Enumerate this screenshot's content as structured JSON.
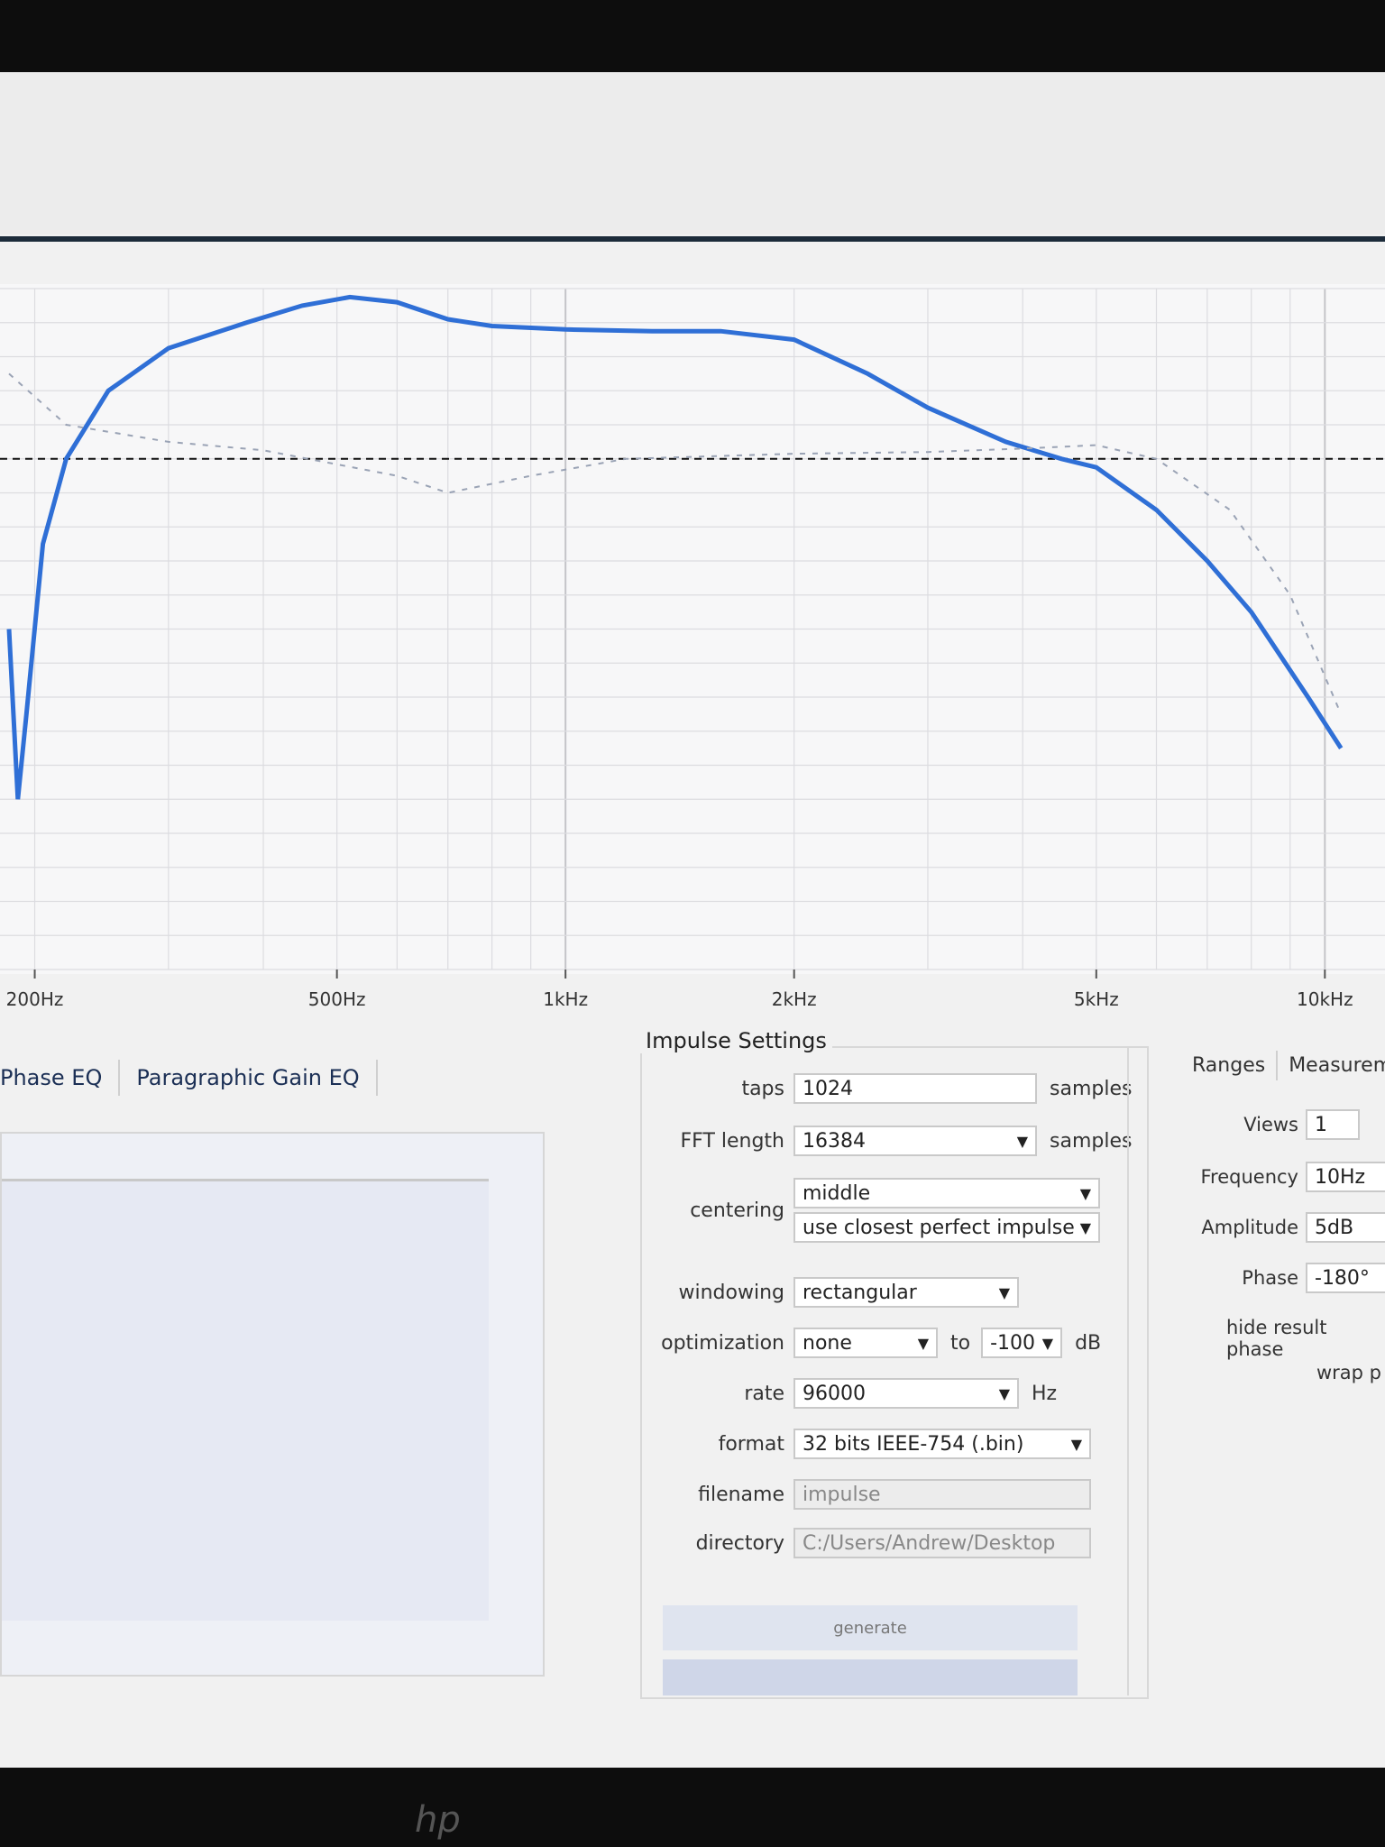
{
  "chart_data": {
    "type": "line",
    "x_scale": "log",
    "x_ticks": [
      "200Hz",
      "500Hz",
      "1kHz",
      "2kHz",
      "5kHz",
      "10kHz"
    ],
    "x_tick_values": [
      200,
      500,
      1000,
      2000,
      5000,
      10000
    ],
    "xlim": [
      180,
      12000
    ],
    "ylim": [
      -30,
      10
    ],
    "grid": true,
    "zero_line": 0,
    "series": [
      {
        "style": "solid",
        "color": "#2f6fd6",
        "points": [
          [
            185,
            -10
          ],
          [
            190,
            -20
          ],
          [
            195,
            -15
          ],
          [
            205,
            -5
          ],
          [
            220,
            0
          ],
          [
            250,
            4
          ],
          [
            300,
            6.5
          ],
          [
            380,
            8
          ],
          [
            450,
            9
          ],
          [
            520,
            9.5
          ],
          [
            600,
            9.2
          ],
          [
            700,
            8.2
          ],
          [
            800,
            7.8
          ],
          [
            1000,
            7.6
          ],
          [
            1300,
            7.5
          ],
          [
            1600,
            7.5
          ],
          [
            2000,
            7
          ],
          [
            2500,
            5
          ],
          [
            3000,
            3
          ],
          [
            3800,
            1
          ],
          [
            4500,
            0
          ],
          [
            5000,
            -0.5
          ],
          [
            6000,
            -3
          ],
          [
            7000,
            -6
          ],
          [
            8000,
            -9
          ],
          [
            9500,
            -14
          ],
          [
            10500,
            -17
          ]
        ]
      },
      {
        "style": "dashed",
        "color": "#9aa3b5",
        "points": [
          [
            185,
            5
          ],
          [
            220,
            2
          ],
          [
            300,
            1
          ],
          [
            400,
            0.5
          ],
          [
            600,
            -1
          ],
          [
            700,
            -2
          ],
          [
            900,
            -1
          ],
          [
            1200,
            0
          ],
          [
            2000,
            0.3
          ],
          [
            3000,
            0.4
          ],
          [
            4000,
            0.6
          ],
          [
            5000,
            0.8
          ],
          [
            6000,
            0
          ],
          [
            7500,
            -3
          ],
          [
            9000,
            -8
          ],
          [
            10500,
            -15
          ]
        ]
      }
    ]
  },
  "tabs": {
    "tab1": "Phase EQ",
    "tab2": "Paragraphic Gain EQ"
  },
  "impulse": {
    "title": "Impulse Settings",
    "taps_label": "taps",
    "taps": "1024",
    "taps_unit": "samples",
    "fft_label": "FFT length",
    "fft": "16384",
    "fft_unit": "samples",
    "centering_label": "centering",
    "centering1": "middle",
    "centering2": "use closest perfect impulse",
    "windowing_label": "windowing",
    "windowing": "rectangular",
    "optimization_label": "optimization",
    "optimization": "none",
    "to": "to",
    "db": "-100",
    "db_unit": "dB",
    "rate_label": "rate",
    "rate": "96000",
    "rate_unit": "Hz",
    "format_label": "format",
    "format": "32 bits IEEE-754 (.bin)",
    "filename_label": "filename",
    "filename": "impulse",
    "directory_label": "directory",
    "directory": "C:/Users/Andrew/Desktop",
    "generate": "generate"
  },
  "right": {
    "tab_ranges": "Ranges",
    "tab_measure": "Measuremer",
    "views_label": "Views",
    "views": "1",
    "freq_label": "Frequency",
    "freq": "10Hz",
    "amp_label": "Amplitude",
    "amp": "5dB",
    "phase_label": "Phase",
    "phase": "-180°",
    "hide": "hide result phase",
    "wrap": "wrap p"
  },
  "brand": "hp"
}
